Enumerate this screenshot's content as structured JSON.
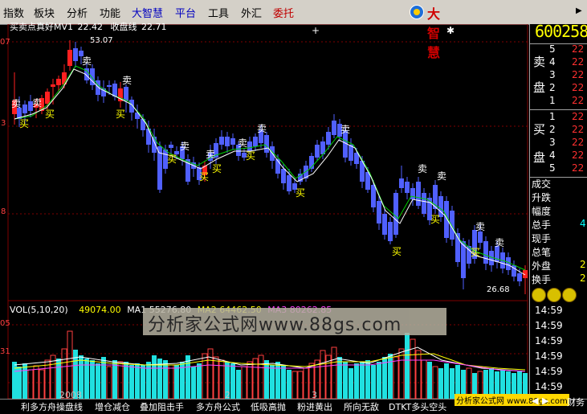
{
  "menu": {
    "items": [
      "指数",
      "板块",
      "分析",
      "功能",
      "大智慧",
      "平台",
      "工具",
      "外汇",
      "委托"
    ],
    "logo": "大智慧",
    "maximize": "▶"
  },
  "price_panel": {
    "indicator_name": "买卖点真好",
    "ma_label": "MV1",
    "ma_value": "22.42",
    "close_label": "收盘线",
    "close_value": "22.71",
    "axis_labels": [
      "07",
      "3",
      "8"
    ],
    "high_label": "53.07",
    "low_label": "26.68",
    "buy_label": "买",
    "sell_label": "卖",
    "colors": {
      "up": "#ff2020",
      "down": "#5060ff",
      "ma": "#00d000",
      "grid": "#800000"
    }
  },
  "volume_panel": {
    "vol_label": "VOL(5,10,20)",
    "vol_value": "49074.00",
    "ma1_label": "MA1",
    "ma1_value": "55276.80",
    "ma2_label": "MA2",
    "ma2_value": "64462.50",
    "ma3_label": "MA3",
    "ma3_value": "80262.85",
    "axis_labels": [
      "05",
      "31"
    ],
    "year_label": "2008",
    "month_labels": [
      "2",
      "3"
    ]
  },
  "watermark": "分析家公式网www.88gs.com",
  "right_panel": {
    "code": "600258",
    "sell_label_1": "卖",
    "sell_label_2": "盘",
    "buy_label_1": "买",
    "buy_label_2": "盘",
    "sell_levels": [
      "5",
      "4",
      "3",
      "2",
      "1"
    ],
    "sell_prices": [
      "22",
      "22",
      "22",
      "22",
      "22"
    ],
    "buy_levels": [
      "1",
      "2",
      "3",
      "4",
      "5"
    ],
    "buy_prices": [
      "22",
      "22",
      "22",
      "22",
      "22"
    ],
    "stats": [
      "成交",
      "升跌",
      "幅度",
      "总手",
      "现手",
      "总笔",
      "外盘",
      "换手"
    ],
    "stats_vals": [
      "",
      "",
      "",
      "4",
      "",
      "",
      "2",
      "2"
    ],
    "times": [
      "14:59",
      "14:59",
      "14:59",
      "14:59",
      "14:59",
      "14:59",
      "14:59"
    ]
  },
  "bottom_tabs": [
    "利多方舟操盘线",
    "增仓减仓",
    "叠加阻击手",
    "多方舟公式",
    "低吸高抛",
    "粉进黄出",
    "所向无敌",
    "DTKT多头空头"
  ],
  "bottom_badge": "分析家公式网 www.88gs.com",
  "bottom_right": "财务"
}
